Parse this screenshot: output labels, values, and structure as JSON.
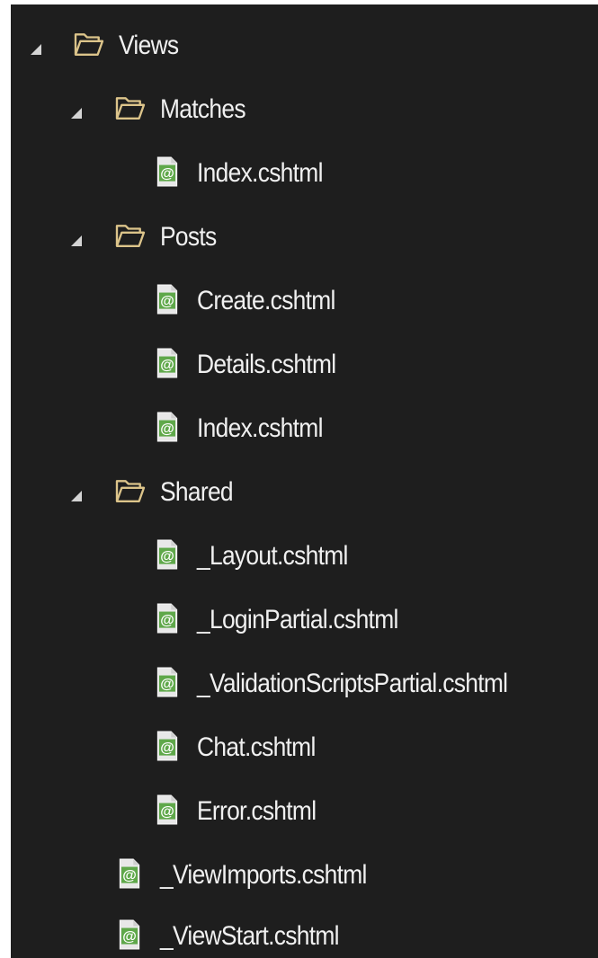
{
  "solution_explorer": {
    "views_folder": {
      "label": "Views",
      "expanded": true,
      "icon": "folder-open-icon",
      "children": {
        "matches_folder": {
          "label": "Matches",
          "expanded": true,
          "icon": "folder-open-icon",
          "files": [
            "Index.cshtml"
          ]
        },
        "posts_folder": {
          "label": "Posts",
          "expanded": true,
          "icon": "folder-open-icon",
          "files": [
            "Create.cshtml",
            "Details.cshtml",
            "Index.cshtml"
          ]
        },
        "shared_folder": {
          "label": "Shared",
          "expanded": true,
          "icon": "folder-open-icon",
          "files": [
            "_Layout.cshtml",
            "_LoginPartial.cshtml",
            "_ValidationScriptsPartial.cshtml",
            "Chat.cshtml",
            "Error.cshtml"
          ]
        },
        "root_files": [
          "_ViewImports.cshtml",
          "_ViewStart.cshtml"
        ]
      }
    },
    "colors": {
      "background": "#1e1e1e",
      "text": "#f0f0f0",
      "folder_outline": "#dcc48a",
      "razor_icon_green": "#5fa84a",
      "expander": "#d4d4d4"
    },
    "file_icon": "razor-file-icon",
    "expander_icon": "expanded-triangle-icon"
  }
}
